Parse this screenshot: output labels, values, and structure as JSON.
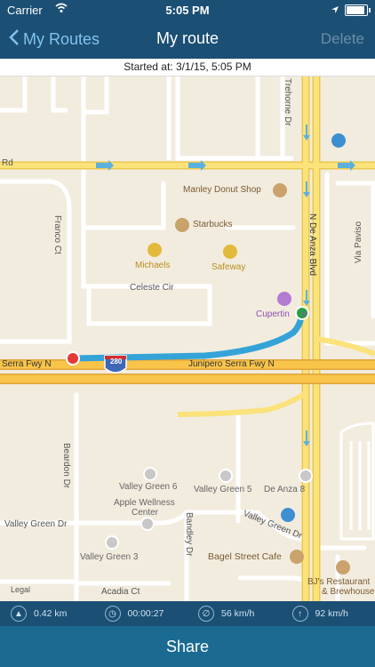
{
  "status": {
    "carrier": "Carrier",
    "time": "5:05 PM"
  },
  "nav": {
    "back_label": "My Routes",
    "title": "My route",
    "delete_label": "Delete"
  },
  "map": {
    "started_text": "Started at: 3/1/15, 5:05 PM",
    "legal": "Legal",
    "streets": {
      "celeste": "Celeste Cir",
      "franco": "Franco Ct",
      "deanza": "N De Anza Blvd",
      "freeway_left": "Serra Fwy N",
      "freeway_right": "Junipero Serra Fwy N",
      "shield": "280",
      "beardon": "Beardon Dr",
      "valley_green_dr_left": "Valley Green Dr",
      "valley_green_dr_right": "Valley Green Dr",
      "bandley": "Bandley Dr",
      "acadia": "Acadia Ct",
      "rd": "Rd",
      "via_paviso": "Via Paviso",
      "trehorne": "Trehorne Dr"
    },
    "pois": {
      "manley": "Manley Donut Shop",
      "starbucks": "Starbucks",
      "michaels": "Michaels",
      "safeway": "Safeway",
      "cupertino": "Cupertin",
      "cupertino_suffix": "n",
      "valley_green_6": "Valley Green 6",
      "valley_green_5": "Valley Green 5",
      "de_anza_8": "De Anza 8",
      "apple_wellness_1": "Apple Wellness",
      "apple_wellness_2": "Center",
      "valley_green_3": "Valley Green 3",
      "bagel": "Bagel Street Cafe",
      "bjs_1": "BJ's Restaurant",
      "bjs_2": "& Brewhouse"
    }
  },
  "stats": {
    "distance": "0.42 km",
    "duration": "00:00:27",
    "max_speed": "56 km/h",
    "avg_speed": "92 km/h"
  },
  "share_label": "Share",
  "colors": {
    "nav": "#1c4f74",
    "share": "#1a6a92",
    "route": "#34a3d8",
    "start_pin": "#e53935",
    "end_pin": "#2e9d4a"
  }
}
